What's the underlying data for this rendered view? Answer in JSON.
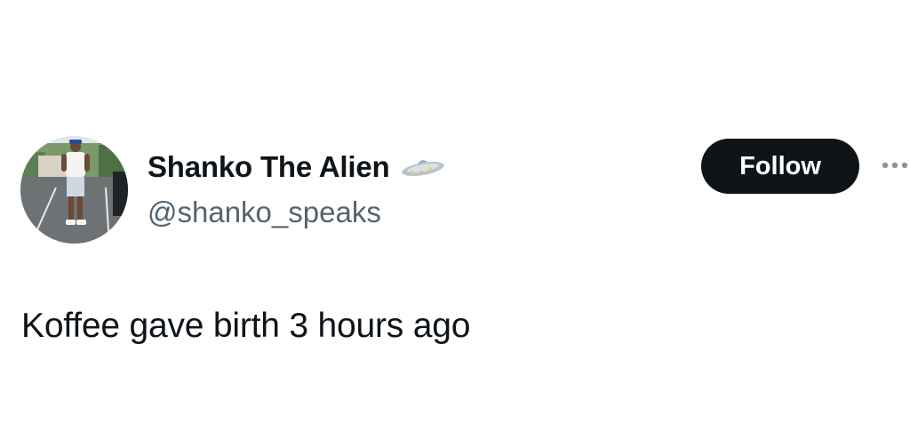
{
  "tweet": {
    "author": {
      "display_name": "Shanko The Alien",
      "handle": "@shanko_speaks",
      "name_emoji_icon": "ufo-icon",
      "avatar_icon": "user-avatar-photo"
    },
    "follow_label": "Follow",
    "more_icon": "more-horizontal-icon",
    "text": "Koffee gave birth 3 hours ago"
  },
  "colors": {
    "text_primary": "#0f1419",
    "text_secondary": "#536471",
    "follow_bg": "#0f1419",
    "follow_text": "#ffffff",
    "background": "#ffffff"
  }
}
